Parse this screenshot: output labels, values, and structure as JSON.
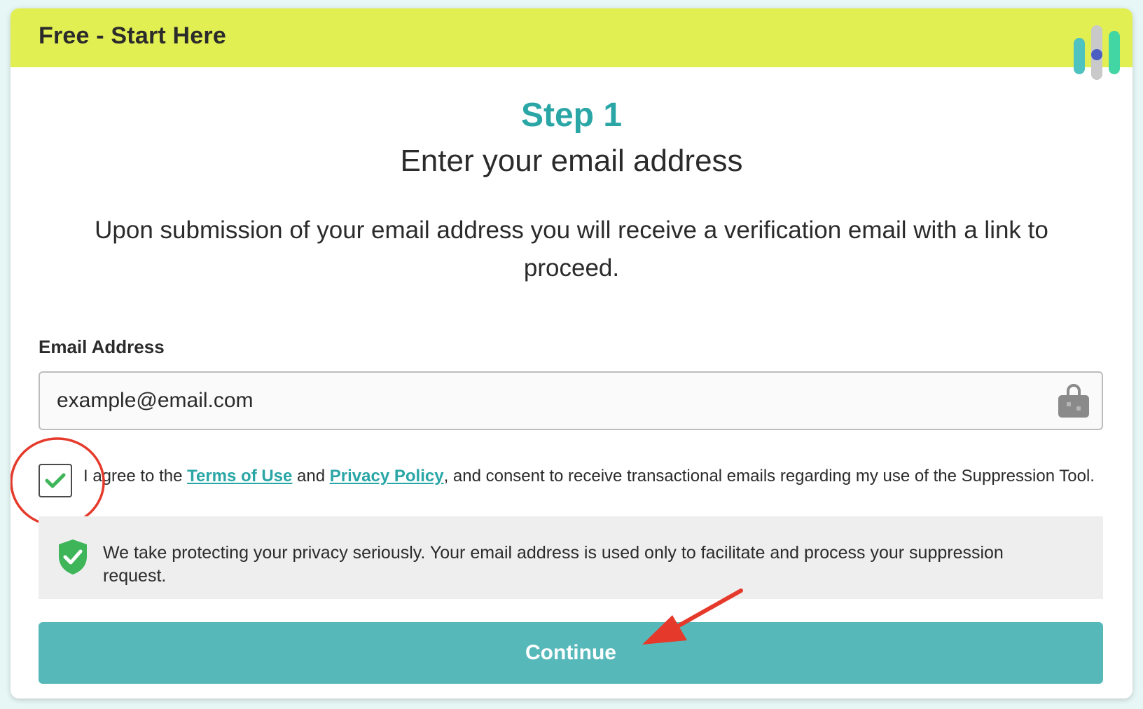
{
  "header": {
    "title": "Free - Start Here",
    "logo": "brand-logo-bars",
    "background_color": "#e2ef52"
  },
  "step": {
    "title": "Step 1",
    "subtitle": "Enter your email address",
    "description": "Upon submission of your email address you will receive a verification email with a link to proceed."
  },
  "form": {
    "email_label": "Email Address",
    "email_value": "example@email.com",
    "email_icon": "password-manager-lock-icon",
    "consent": {
      "checked": true,
      "prefix": "I agree to the ",
      "terms_link": "Terms of Use",
      "middle": " and ",
      "privacy_link": "Privacy Policy",
      "suffix": ", and consent to receive transactional emails regarding my use of the Suppression Tool."
    }
  },
  "privacy_notice": {
    "icon": "shield-check-icon",
    "text": "We take protecting your privacy seriously. Your email address is used only to facilitate and process your suppression request."
  },
  "actions": {
    "continue_label": "Continue"
  },
  "annotations": {
    "circle": "red-circle-annotation",
    "arrow": "red-arrow-annotation"
  },
  "colors": {
    "accent": "#2aa6a6",
    "button": "#57b8ba",
    "annotation": "#e53a2b",
    "check": "#3fb55a"
  }
}
